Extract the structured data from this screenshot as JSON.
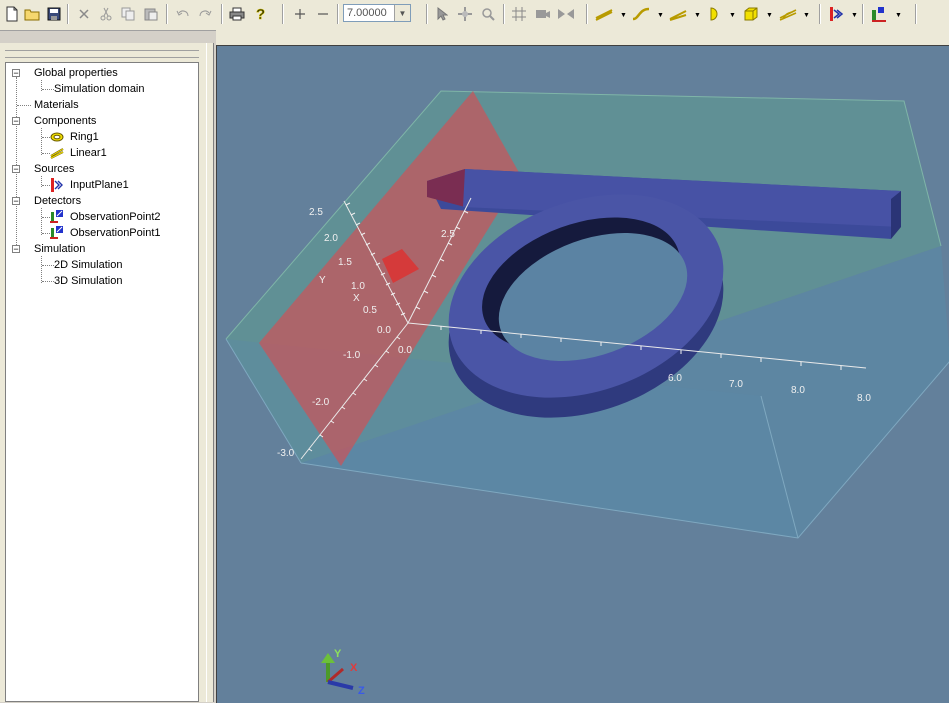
{
  "toolbar": {
    "zoom_value": "7.00000",
    "icons": [
      "new-file-icon",
      "open-folder-icon",
      "save-icon",
      "cut-x-icon",
      "scissors-icon",
      "copy-icon",
      "paste-icon",
      "undo-icon",
      "redo-icon",
      "print-icon",
      "help-icon",
      "zoom-in-plus-icon",
      "zoom-out-minus-icon",
      "select-arrow-icon",
      "pan-icon",
      "zoom-magnifier-icon",
      "grid-icon",
      "camera-icon",
      "bowtie-icon",
      "linear-waveguide-icon",
      "s-bend-icon",
      "taper-icon",
      "half-circle-icon",
      "cube-icon",
      "coupler-icon",
      "input-plane-icon",
      "detector-icon"
    ]
  },
  "tree": {
    "items": [
      {
        "label": "Global properties",
        "level": 0
      },
      {
        "label": "Simulation domain",
        "level": 1
      },
      {
        "label": "Materials",
        "level": 0
      },
      {
        "label": "Components",
        "level": 0
      },
      {
        "label": "Ring1",
        "level": 1
      },
      {
        "label": "Linear1",
        "level": 1
      },
      {
        "label": "Sources",
        "level": 0
      },
      {
        "label": "InputPlane1",
        "level": 1
      },
      {
        "label": "Detectors",
        "level": 0
      },
      {
        "label": "ObservationPoint2",
        "level": 1
      },
      {
        "label": "ObservationPoint1",
        "level": 1
      },
      {
        "label": "Simulation",
        "level": 0
      },
      {
        "label": "2D Simulation",
        "level": 1
      },
      {
        "label": "3D Simulation",
        "level": 1
      }
    ]
  },
  "viewport": {
    "background": "#63809b",
    "y_ticks": [
      "2.5",
      "2.0",
      "1.5",
      "1.0",
      "0.5",
      "0.0",
      "-1.0",
      "-2.0",
      "-3.0"
    ],
    "y_label": "Y",
    "x_label": "X",
    "x_ticks": [
      "0.0",
      "6.0",
      "7.0",
      "8.0"
    ],
    "z_tick": "2.5",
    "axes_gizmo": {
      "y": "Y",
      "x": "X",
      "z": "Z"
    }
  }
}
